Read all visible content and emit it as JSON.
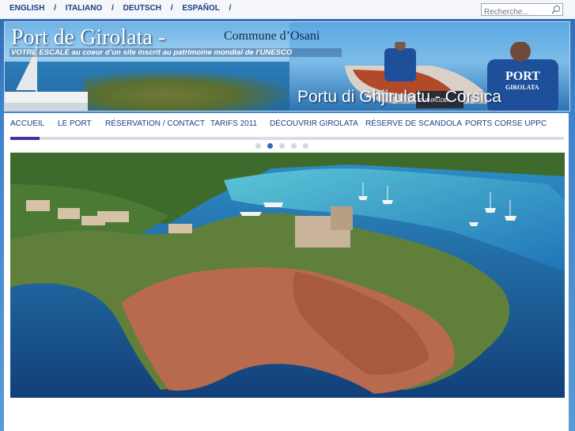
{
  "languages": [
    "ENGLISH",
    "ITALIANO",
    "DEUTSCH",
    "ESPAÑOL"
  ],
  "separator": "/",
  "search": {
    "placeholder": "Recherche..."
  },
  "banner": {
    "title": "Port de Girolata -",
    "commune": "Commune d’Osani",
    "escale": "VOTRE ESCALE au coeur d’un site inscrit au patrimoine mondial de l’UNESCO",
    "portu": "Portu di Ghjirulatu - Corsica",
    "shirt_text": [
      "PORT",
      "GIROLATA"
    ],
    "engine_brand": "EVINRUDE"
  },
  "nav": {
    "items": [
      "ACCUEIL",
      "LE PORT",
      "RÉSERVATION / CONTACT",
      "TARIFS 2011",
      "DÉCOUVRIR GIROLATA",
      "RÉSERVE DE SCANDOLA",
      "PORTS CORSE UPPC"
    ],
    "active_index": 0
  },
  "slider": {
    "count": 5,
    "active_index": 1
  },
  "colors": {
    "background": "#3f82cc",
    "nav_text": "#1b3f86",
    "active_underline": "#4b2fa2",
    "slider_dot_active": "#2f6fb0"
  }
}
